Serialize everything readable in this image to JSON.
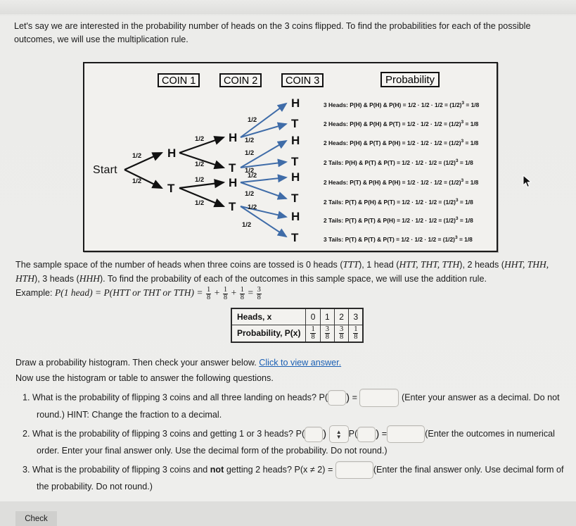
{
  "intro": {
    "text": "Let's say we are interested in the probability number of heads on the 3 coins flipped. To find the probabilities for each of the possible outcomes, we will use the multiplication rule."
  },
  "figure": {
    "headers": {
      "coin1": "COIN 1",
      "coin2": "COIN 2",
      "coin3": "COIN 3",
      "probability": "Probability"
    },
    "start_label": "Start",
    "branch_prob": "1/2",
    "level1_nodes": [
      "H",
      "T"
    ],
    "level2_nodes": [
      "H",
      "T",
      "H",
      "T"
    ],
    "level3_nodes": [
      "H",
      "T",
      "H",
      "T",
      "H",
      "T",
      "H",
      "T"
    ],
    "probability_rows": [
      {
        "outcome": "3 Heads:",
        "expr": "P(H) & P(H) & P(H) = 1/2 · 1/2 · 1/2 = (1/2)",
        "exp": "3",
        "result": "= 1/8"
      },
      {
        "outcome": "2 Heads:",
        "expr": "P(H) & P(H) & P(T) = 1/2 · 1/2 · 1/2 = (1/2)",
        "exp": "3",
        "result": "= 1/8"
      },
      {
        "outcome": "2 Heads:",
        "expr": "P(H) & P(T) & P(H) = 1/2 · 1/2 · 1/2 = (1/2)",
        "exp": "3",
        "result": "= 1/8"
      },
      {
        "outcome": "2 Tails:",
        "expr": "P(H) & P(T) & P(T) = 1/2 · 1/2 · 1/2 = (1/2)",
        "exp": "3",
        "result": "= 1/8"
      },
      {
        "outcome": "2 Heads:",
        "expr": "P(T) & P(H) & P(H) = 1/2 · 1/2 · 1/2 = (1/2)",
        "exp": "3",
        "result": "= 1/8"
      },
      {
        "outcome": "2 Tails:",
        "expr": "P(T) & P(H) & P(T) = 1/2 · 1/2 · 1/2 = (1/2)",
        "exp": "3",
        "result": "= 1/8"
      },
      {
        "outcome": "2 Tails:",
        "expr": "P(T) & P(T) & P(H) = 1/2 · 1/2 · 1/2 = (1/2)",
        "exp": "3",
        "result": "= 1/8"
      },
      {
        "outcome": "3 Tails:",
        "expr": "P(T) & P(T) & P(T) = 1/2 · 1/2 · 1/2 = (1/2)",
        "exp": "3",
        "result": "= 1/8"
      }
    ],
    "colors": {
      "edge_black": "#111111",
      "edge_blue": "#3f6ca8",
      "frame": "#1a1a1a",
      "paper": "#f2f1ee"
    }
  },
  "sample_space": {
    "part1": "The sample space of the number of heads when three coins are tossed is 0 heads (",
    "ttt": "TTT",
    "part2": "), 1 head (",
    "one_head_set": "HTT, THT, TTH",
    "part3": "), 2 heads (",
    "two_head_set": "HHT, THH, HTH",
    "part4": "), 3 heads (",
    "three_head_set": "HHH",
    "part5": "). To find the probability of each of the outcomes in this sample space, we will use the addition rule.",
    "example_label": "Example:",
    "example_lhs": "P(1 head) = P(HTT or THT or TTH) =",
    "f1_num": "1",
    "f1_den": "8",
    "plus1": "+",
    "f2_num": "1",
    "f2_den": "8",
    "plus2": "+",
    "f3_num": "1",
    "f3_den": "8",
    "equals": "=",
    "f4_num": "3",
    "f4_den": "8"
  },
  "dist_table": {
    "row1_header": "Heads, x",
    "row1_values": [
      "0",
      "1",
      "2",
      "3"
    ],
    "row2_header": "Probability, P(x)",
    "row2_values": [
      {
        "num": "1",
        "den": "8"
      },
      {
        "num": "3",
        "den": "8"
      },
      {
        "num": "3",
        "den": "8"
      },
      {
        "num": "1",
        "den": "8"
      }
    ]
  },
  "instructions": {
    "draw_text": "Draw a probability histogram. Then check your answer below.",
    "link_text": "Click to view answer.",
    "now_use_text": "Now use the histogram or table to answer the following questions."
  },
  "questions": [
    {
      "number": "1.",
      "prompt": "What is the probability of flipping 3 coins and all three landing on heads? P(",
      "close_paren": ")",
      "eq": "=",
      "input1_value": "",
      "input2_value": "",
      "note": "(Enter your answer as a decimal. Do not",
      "note_cont": "round.) HINT: Change the fraction to a decimal."
    },
    {
      "number": "2.",
      "prompt": "What is the probability of flipping 3 coins and getting 1 or 3 heads? P(",
      "close_paren": ")",
      "mid_label": "P(",
      "eq": "=",
      "selector_value": "",
      "selector_icon": "up-down-chevron-icon",
      "input1_value": "",
      "input2_value": "",
      "input3_value": "",
      "note": "(Enter the outcomes in numerical",
      "note_cont": "order. Enter your final answer only. Use the decimal form of the probability. Do not round.)"
    },
    {
      "number": "3.",
      "prompt_a": "What is the probability of flipping 3 coins and ",
      "prompt_bold": "not",
      "prompt_b": " getting 2 heads? P(x ≠ 2) =",
      "input1_value": "",
      "note": "(Enter the final answer only. Use decimal form of",
      "note_cont": "the probability. Do not round.)"
    }
  ],
  "footer": {
    "check_label": "Check"
  }
}
